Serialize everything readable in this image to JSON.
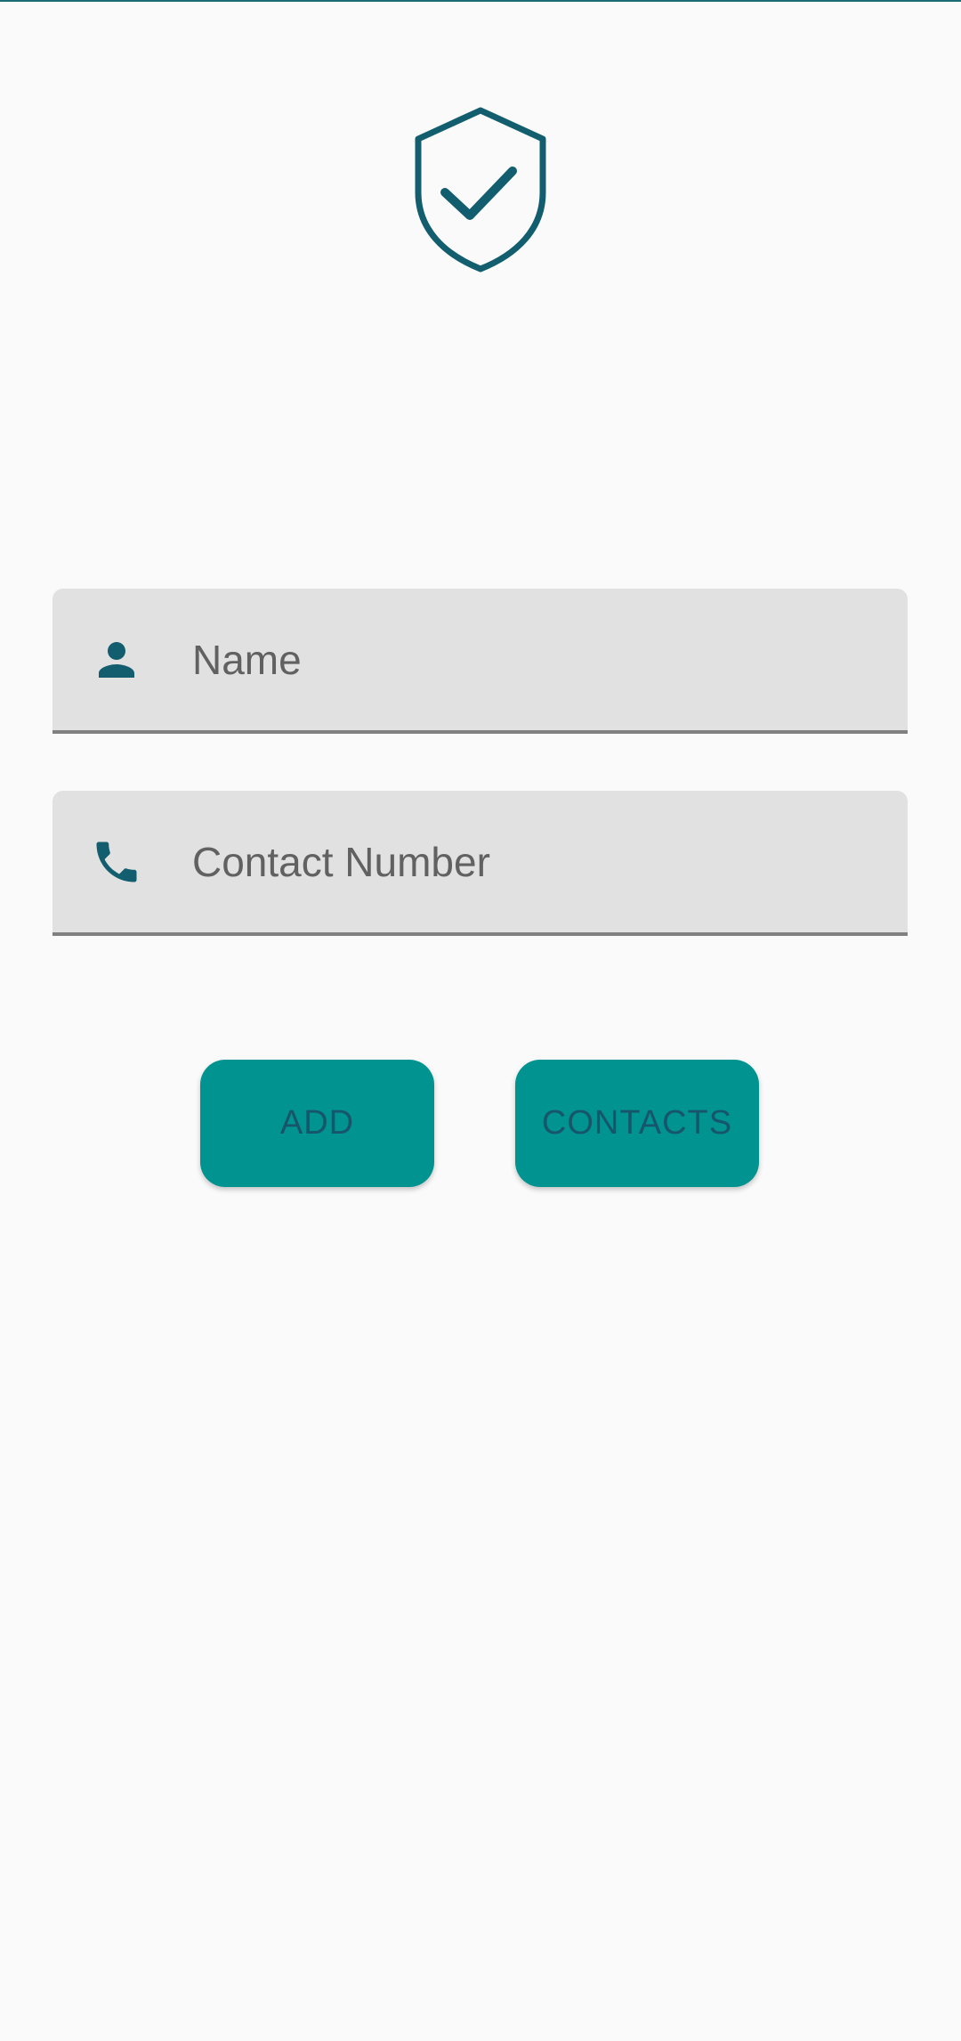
{
  "colors": {
    "primary": "#009390",
    "icon": "#135e6e",
    "field_bg": "#e1e1e1",
    "background": "#fafafa"
  },
  "logo": {
    "icon": "shield-check-icon"
  },
  "form": {
    "name": {
      "placeholder": "Name",
      "icon": "person-icon"
    },
    "contact": {
      "placeholder": "Contact Number",
      "icon": "phone-icon"
    }
  },
  "buttons": {
    "add_label": "ADD",
    "contacts_label": "CONTACTS"
  }
}
